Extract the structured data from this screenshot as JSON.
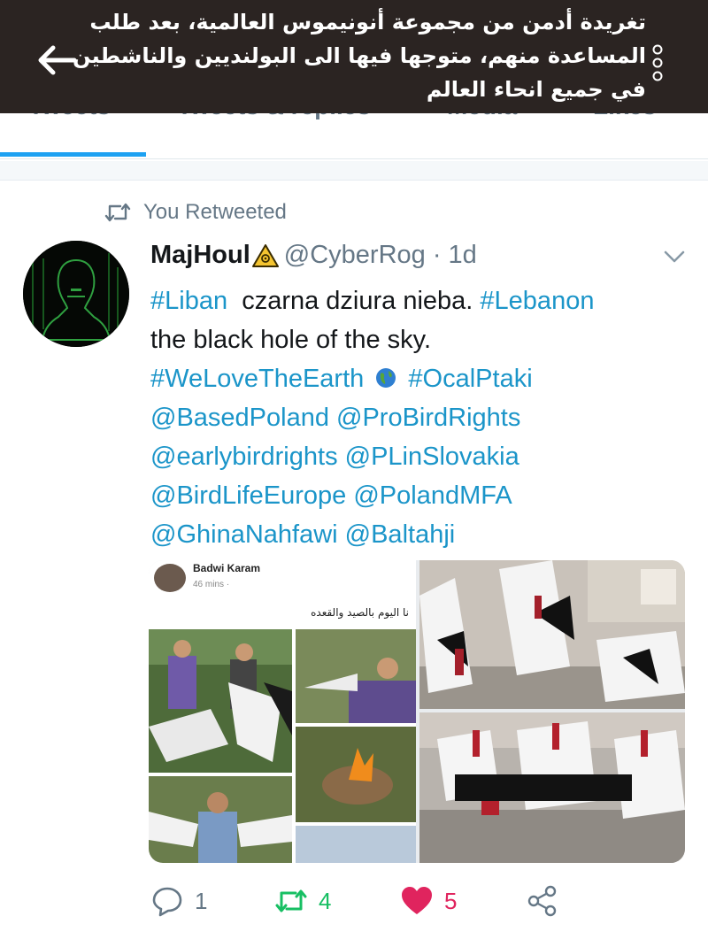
{
  "caption": {
    "line1": "تغريدة أدمن من مجموعة أنونيموس العالمية، بعد طلب",
    "line2": "المساعدة منهم، متوجها فيها الى البولنديين والناشطين",
    "line3": "في جميع انحاء العالم"
  },
  "tabs": [
    "Tweets",
    "Tweets & replies",
    "Media",
    "Likes"
  ],
  "retweet_label": "You Retweeted",
  "tweet": {
    "display_name": "MajHoul",
    "handle_time": "@CyberRog · 1d",
    "line1_tag1": "#Liban",
    "line1_text": "  czarna dziura nieba. ",
    "line1_tag2": "#Lebanon",
    "line2": "the black hole of the sky.",
    "line3_tag1": "#WeLoveTheEarth",
    "line3_tag2": "#OcalPtaki",
    "line4": "@BasedPoland @ProBirdRights",
    "line5": "@earlybirdrights @PLinSlovakia",
    "line6": "@BirdLifeEurope @PolandMFA",
    "line7": "@GhinaNahfawi @Baltahji"
  },
  "media": {
    "fb_name": "Badwi Karam",
    "fb_time": "46 mins ·",
    "fb_post": "نا اليوم بالصيد والقعده"
  },
  "actions": {
    "replies": "1",
    "retweets": "4",
    "likes": "5"
  },
  "icons": {
    "back": "back-arrow-icon",
    "menu": "vertical-dots-icon",
    "retweet": "retweet-icon",
    "warning": "biohazard-warning-icon",
    "globe": "earth-globe-icon",
    "reply": "reply-icon",
    "like": "heart-icon",
    "share": "share-icon"
  },
  "colors": {
    "link": "#1b95c9",
    "retweet_active": "#17bf63",
    "like_active": "#e0245e",
    "caption_bg": "#2b2422"
  }
}
